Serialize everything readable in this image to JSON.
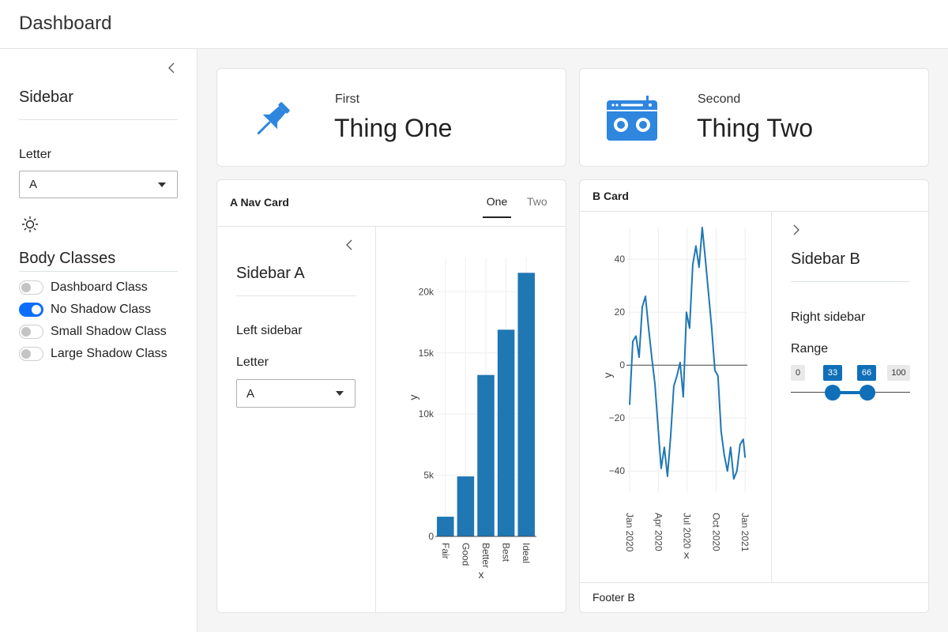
{
  "app": {
    "title": "Dashboard"
  },
  "sidebar": {
    "heading": "Sidebar",
    "letter_label": "Letter",
    "letter_value": "A",
    "body_classes_heading": "Body Classes",
    "switches": [
      {
        "label": "Dashboard Class",
        "checked": false
      },
      {
        "label": "No Shadow Class",
        "checked": true
      },
      {
        "label": "Small Shadow Class",
        "checked": false
      },
      {
        "label": "Large Shadow Class",
        "checked": false
      }
    ]
  },
  "value_boxes": [
    {
      "subtitle": "First",
      "value": "Thing One",
      "icon": "pushpin-icon",
      "color": "#2e86de"
    },
    {
      "subtitle": "Second",
      "value": "Thing Two",
      "icon": "boombox-icon",
      "color": "#2e86de"
    }
  ],
  "nav_card": {
    "title": "A Nav Card",
    "tabs": [
      {
        "label": "One",
        "active": true
      },
      {
        "label": "Two",
        "active": false
      }
    ],
    "sidebar": {
      "heading": "Sidebar A",
      "text": "Left sidebar",
      "letter_label": "Letter",
      "letter_value": "A"
    }
  },
  "b_card": {
    "title": "B Card",
    "footer": "Footer B",
    "sidebar": {
      "heading": "Sidebar B",
      "text": "Right sidebar",
      "range_label": "Range",
      "range_min": "0",
      "range_max": "100",
      "range_from": "33",
      "range_to": "66"
    }
  },
  "chart_data": [
    {
      "type": "bar",
      "categories": [
        "Fair",
        "Good",
        "Better",
        "Best",
        "Ideal"
      ],
      "values": [
        1610,
        4906,
        13200,
        16900,
        21551
      ],
      "xlabel": "x",
      "ylabel": "y",
      "ylim": [
        0,
        22800
      ],
      "yticks": [
        0,
        5000,
        10000,
        15000,
        20000
      ],
      "ytick_labels": [
        "0",
        "5k",
        "10k",
        "15k",
        "20k"
      ],
      "color": "#1f77b4",
      "grid": true
    },
    {
      "type": "line",
      "xlabel": "x",
      "ylabel": "y",
      "xtick_labels": [
        "Jan 2020",
        "Apr 2020",
        "Jul 2020",
        "Oct 2020",
        "Jan 2021"
      ],
      "yticks": [
        -40,
        -20,
        0,
        20,
        40
      ],
      "ytick_labels": [
        "−40",
        "−20",
        "0",
        "20",
        "40"
      ],
      "ylim": [
        -48,
        52
      ],
      "xlim": [
        "2019-12-22",
        "2021-01-08"
      ],
      "color": "#1f77b4",
      "grid": true,
      "x": [
        "2020-01-01",
        "2020-01-11",
        "2020-01-21",
        "2020-01-31",
        "2020-02-10",
        "2020-02-20",
        "2020-03-01",
        "2020-03-11",
        "2020-03-21",
        "2020-03-31",
        "2020-04-10",
        "2020-04-20",
        "2020-04-30",
        "2020-05-10",
        "2020-05-20",
        "2020-05-30",
        "2020-06-09",
        "2020-06-19",
        "2020-06-29",
        "2020-07-09",
        "2020-07-19",
        "2020-07-29",
        "2020-08-08",
        "2020-08-18",
        "2020-08-28",
        "2020-09-07",
        "2020-09-17",
        "2020-09-27",
        "2020-10-07",
        "2020-10-17",
        "2020-10-27",
        "2020-11-06",
        "2020-11-16",
        "2020-11-26",
        "2020-12-06",
        "2020-12-16",
        "2020-12-26",
        "2021-01-01"
      ],
      "y": [
        -15,
        9,
        11,
        3,
        22,
        26,
        14,
        3,
        -7,
        -23,
        -39,
        -31,
        -42,
        -27,
        -8,
        -4,
        1,
        -12,
        20,
        14,
        38,
        45,
        37,
        52,
        40,
        27,
        14,
        -2,
        -4,
        -25,
        -34,
        -40,
        -31,
        -43,
        -40,
        -30,
        -28,
        -35
      ]
    }
  ]
}
